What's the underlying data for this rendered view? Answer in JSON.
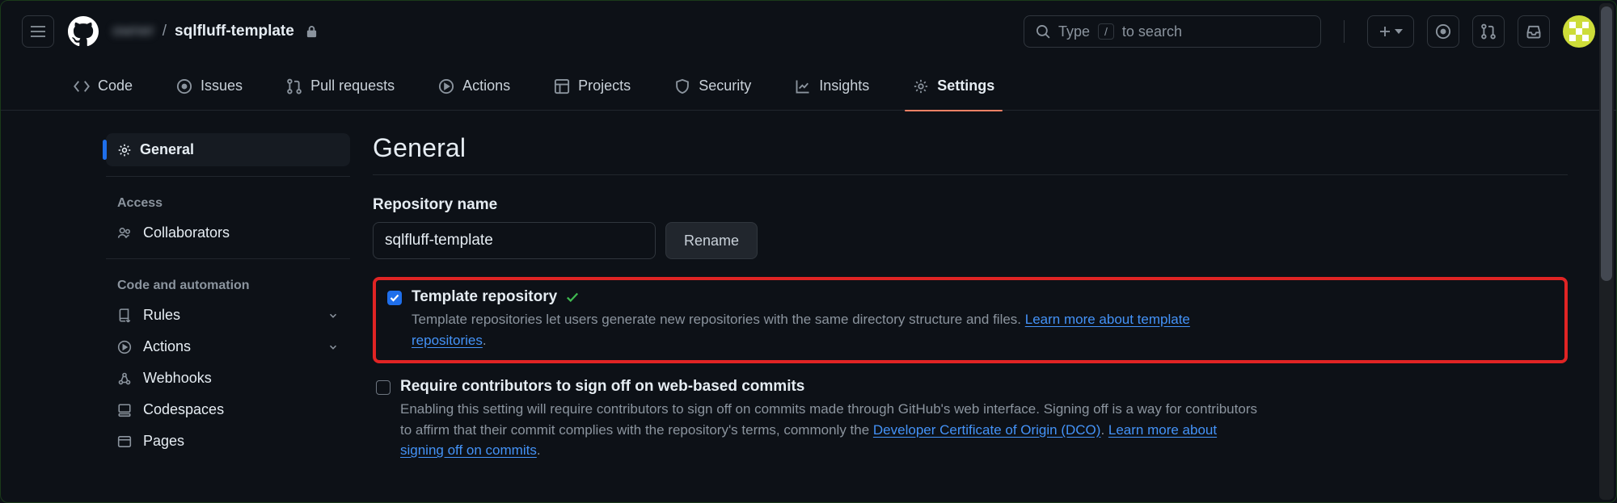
{
  "header": {
    "owner": "owner",
    "repo": "sqlfluff-template",
    "search_prefix": "Type",
    "search_key": "/",
    "search_suffix": "to search"
  },
  "nav": {
    "code": "Code",
    "issues": "Issues",
    "pulls": "Pull requests",
    "actions": "Actions",
    "projects": "Projects",
    "security": "Security",
    "insights": "Insights",
    "settings": "Settings"
  },
  "sidebar": {
    "general": "General",
    "access_heading": "Access",
    "collaborators": "Collaborators",
    "code_heading": "Code and automation",
    "rules": "Rules",
    "actions": "Actions",
    "webhooks": "Webhooks",
    "codespaces": "Codespaces",
    "pages": "Pages"
  },
  "content": {
    "title": "General",
    "repo_name_label": "Repository name",
    "repo_name_value": "sqlfluff-template",
    "rename_button": "Rename",
    "template": {
      "label": "Template repository",
      "desc": "Template repositories let users generate new repositories with the same directory structure and files. ",
      "link": "Learn more about template repositories",
      "period": "."
    },
    "signoff": {
      "label": "Require contributors to sign off on web-based commits",
      "desc1": "Enabling this setting will require contributors to sign off on commits made through GitHub's web interface. Signing off is a way for contributors to affirm that their commit complies with the repository's terms, commonly the ",
      "link1": "Developer Certificate of Origin (DCO)",
      "period1": ". ",
      "link2": "Learn more about signing off on commits",
      "period2": "."
    }
  }
}
